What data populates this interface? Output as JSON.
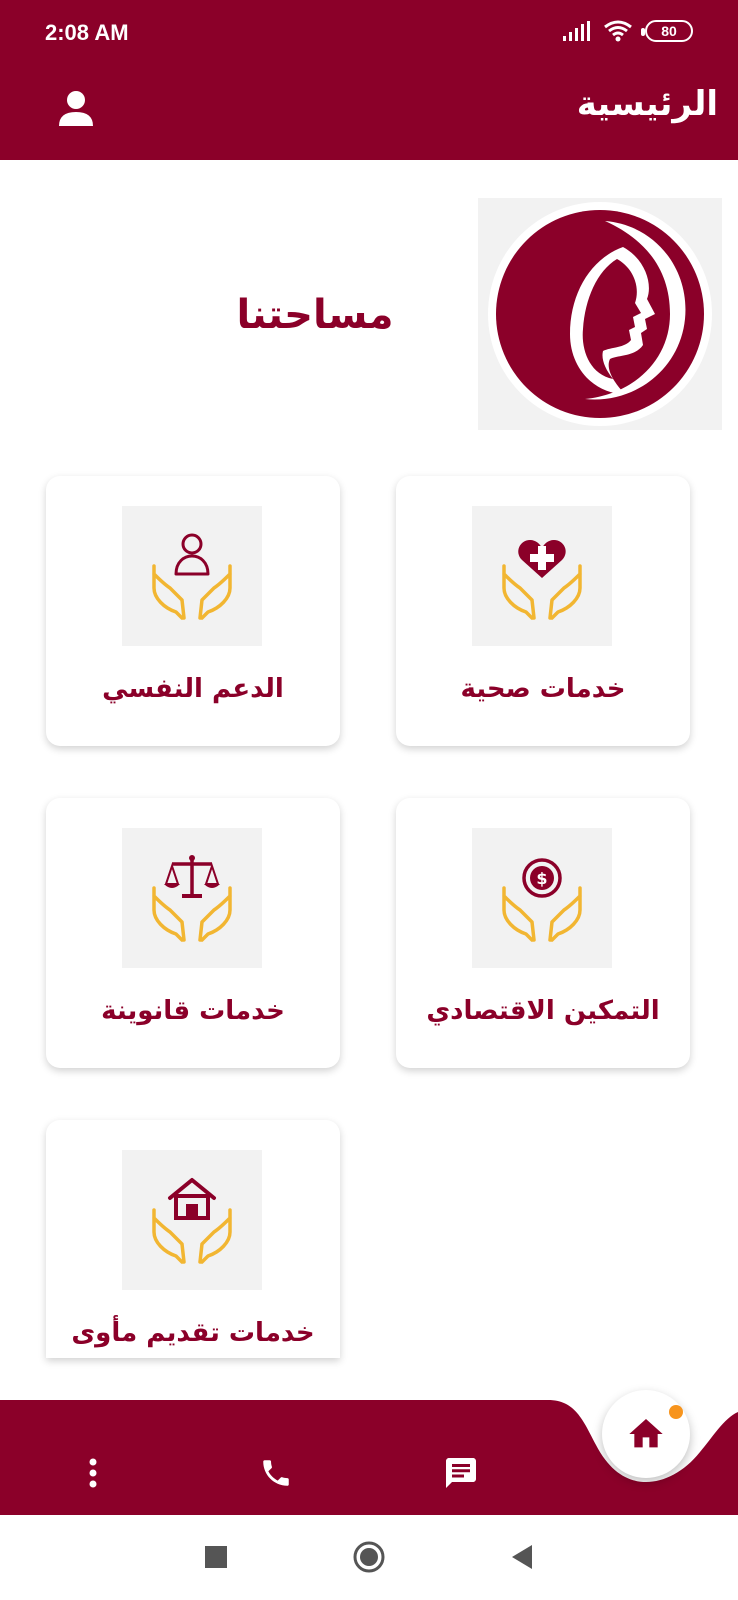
{
  "status_bar": {
    "time": "2:08 AM",
    "battery": "80"
  },
  "header": {
    "title": "الرئيسية"
  },
  "brand": {
    "name": "مساحتنا"
  },
  "cards": [
    {
      "label": "خدمات صحية",
      "icon": "heart-plus-hands-icon"
    },
    {
      "label": "الدعم النفسي",
      "icon": "person-hands-icon"
    },
    {
      "label": "التمكين الاقتصادي",
      "icon": "dollar-coin-hands-icon"
    },
    {
      "label": "خدمات قانوينة",
      "icon": "scales-hands-icon"
    },
    {
      "label": "خدمات تقديم مأوى",
      "icon": "house-hands-icon"
    }
  ],
  "colors": {
    "primary": "#8b0029",
    "accent": "#f2b632",
    "badge": "#f7941d"
  },
  "bottom_nav": [
    "more-vert-icon",
    "phone-icon",
    "chat-icon",
    "home-icon"
  ]
}
